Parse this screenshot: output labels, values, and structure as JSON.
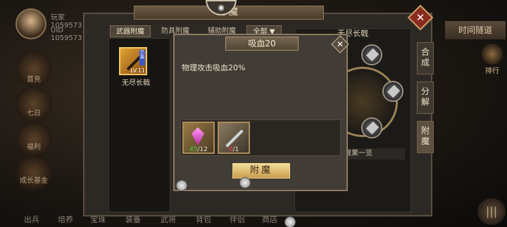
{
  "background": {
    "player": {
      "name": "玩家1059573",
      "uid": "UID 1059573"
    },
    "left_menu": [
      "首充",
      "七日",
      "福利",
      "成长基金"
    ],
    "bottom_menu": [
      "出兵",
      "培养",
      "宝珠",
      "装备",
      "武将",
      "背包",
      "伴侣",
      "商店"
    ],
    "time_limit_label": "时间隧道",
    "rank_label": "排行"
  },
  "window": {
    "title": "附魔",
    "tabs": [
      "武器附魔",
      "防具附魔",
      "辅助附魔",
      "全部"
    ],
    "inventory": {
      "item_name": "无尽长戟",
      "item_level": "LV.11"
    },
    "detail_title": "无尽长戟",
    "effect_list_label": "效果一览",
    "side_tabs": [
      "合成",
      "分解",
      "附魔"
    ]
  },
  "popup": {
    "title": "吸血20",
    "description": "物理攻击吸血20%",
    "materials": [
      {
        "name": "purple-gem",
        "have": "45",
        "need": "/12"
      },
      {
        "name": "blade",
        "have": "0",
        "need": "/1"
      }
    ],
    "confirm_label": "附魔"
  },
  "colors": {
    "accent_gold": "#c99e4c",
    "ok_green": "#4bd94b",
    "lack_red": "#ff3b3b"
  }
}
